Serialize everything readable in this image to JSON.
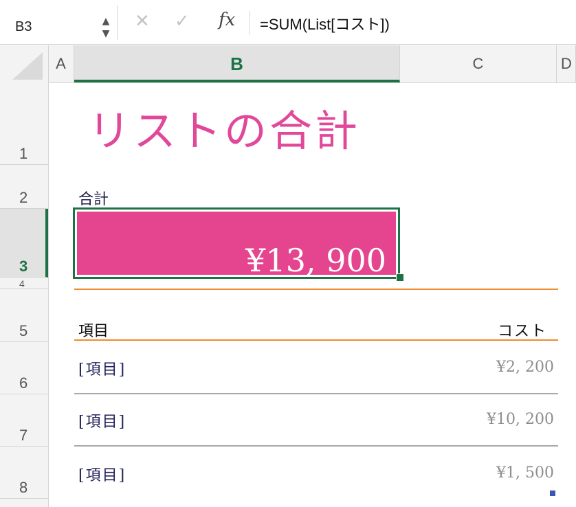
{
  "formula_bar": {
    "name_box": "B3",
    "stepper_up": "▲",
    "stepper_down": "▼",
    "cancel": "✕",
    "enter": "✓",
    "fx": "fx",
    "formula": "=SUM(List[コスト])"
  },
  "columns": [
    "A",
    "B",
    "C",
    "D"
  ],
  "rows": [
    "1",
    "2",
    "3",
    "4",
    "5",
    "6",
    "7",
    "8"
  ],
  "sheet": {
    "title": "リストの合計",
    "total_label": "合計",
    "total_value": "¥13, 900",
    "table": {
      "headers": {
        "item": "項目",
        "cost": "コスト"
      },
      "rows": [
        {
          "item": "[項目]",
          "cost": "¥2, 200"
        },
        {
          "item": "[項目]",
          "cost": "¥10, 200"
        },
        {
          "item": "[項目]",
          "cost": "¥1, 500"
        }
      ]
    }
  },
  "colors": {
    "accent_green": "#1e7145",
    "title_pink": "#e1489a",
    "total_fill": "#e5458f",
    "orange_rule": "#f08a2a"
  }
}
